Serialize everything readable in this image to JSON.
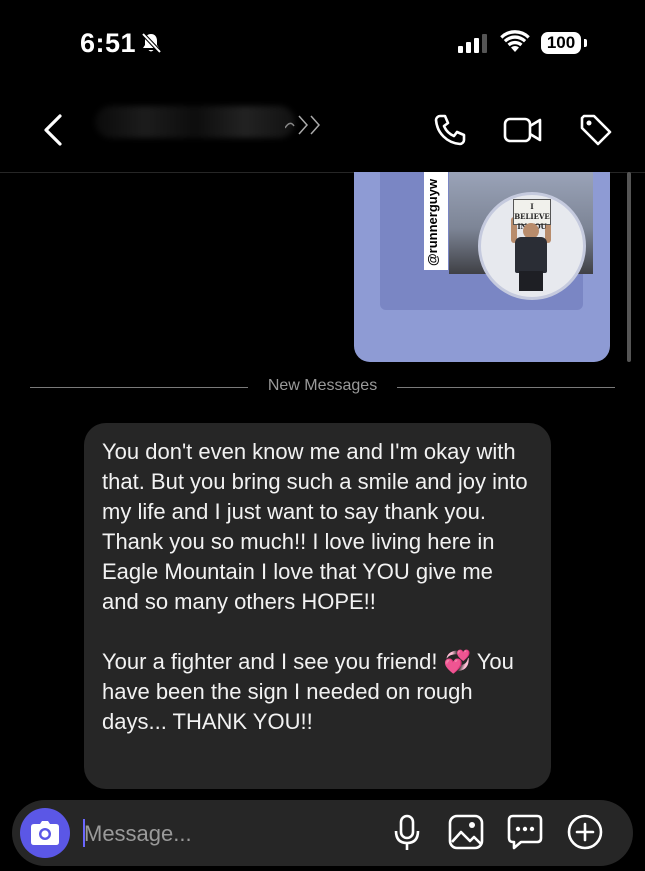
{
  "status_bar": {
    "time": "6:51",
    "battery": "100"
  },
  "header": {
    "contact_name": "(blurred)",
    "icons": [
      "back-icon",
      "phone-icon",
      "video-icon",
      "tag-icon"
    ]
  },
  "story": {
    "handle": "@runnerguyw",
    "sign_text": "I BELIEVE IN YOU"
  },
  "divider": {
    "label": "New Messages"
  },
  "message": {
    "paragraph1": "You don't even know me and I'm okay with that. But you bring such a smile and joy into my life and I just want to say thank you. Thank you so much!! I love living here in Eagle Mountain I love that YOU give me and so many others HOPE!!",
    "paragraph2": "Your a fighter and I see you friend! 💞 You have been the sign I needed on rough days... THANK YOU!!"
  },
  "composer": {
    "placeholder": "Message...",
    "icons": [
      "camera-icon",
      "microphone-icon",
      "gallery-icon",
      "sticker-icon",
      "plus-icon"
    ]
  },
  "colors": {
    "background": "#000000",
    "bubble": "#262626",
    "accent": "#5b57e6",
    "story_bg": "#8e9bd4"
  }
}
